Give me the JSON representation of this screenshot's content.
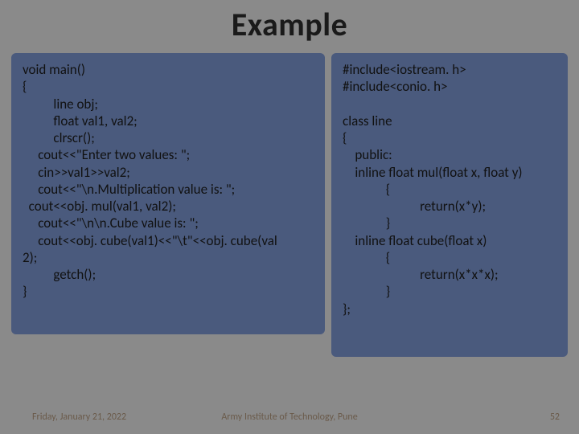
{
  "title": "Example",
  "left_code": "void main()\n{\n          line obj;\n          float val1, val2;\n          clrscr();\n     cout<<\"Enter two values: \";\n     cin>>val1>>val2;\n     cout<<\"\\n.Multiplication value is: \";\n  cout<<obj. mul(val1, val2);\n     cout<<\"\\n\\n.Cube value is: \";\n     cout<<obj. cube(val1)<<\"\\t\"<<obj. cube(val\n2);\n          getch();\n}",
  "right_code": "#include<iostream. h>\n#include<conio. h>\n\nclass line\n{\n    public:\n    inline float mul(float x, float y)\n              {\n                         return(x*y);\n              }\n    inline float cube(float x)\n              {\n                         return(x*x*x);\n              }\n};",
  "footer": {
    "date": "Friday, January 21, 2022",
    "org": "Army Institute of Technology, Pune",
    "page": "52"
  }
}
